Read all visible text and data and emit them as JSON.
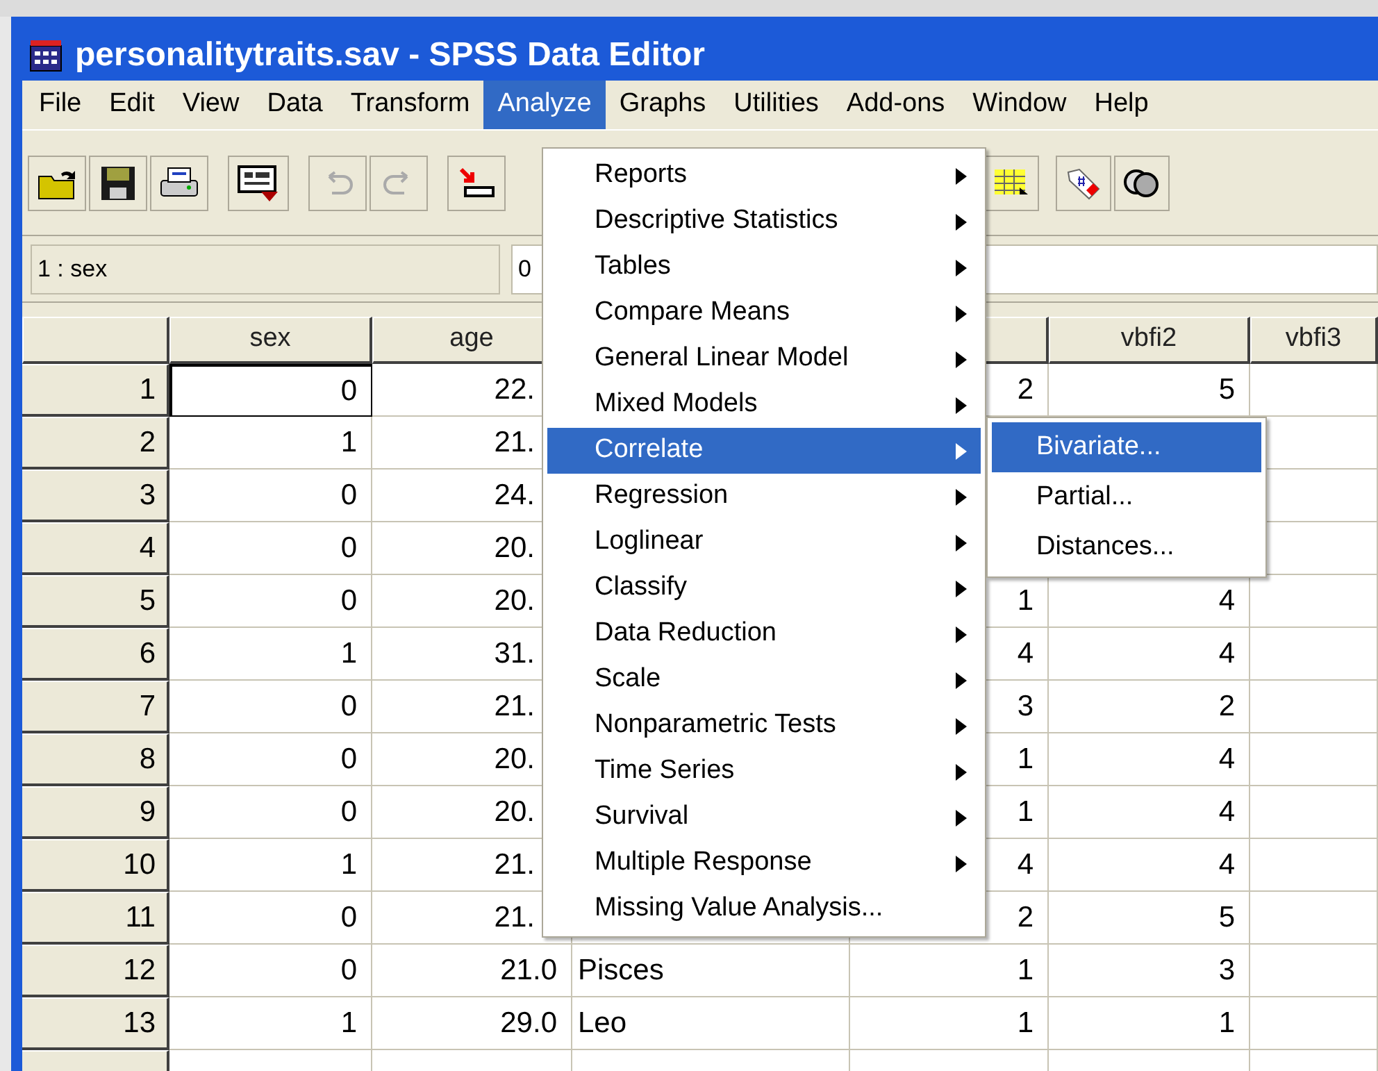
{
  "window": {
    "title": "personalitytraits.sav - SPSS Data Editor"
  },
  "menu_bar": [
    {
      "label": "File",
      "selected": false
    },
    {
      "label": "Edit",
      "selected": false
    },
    {
      "label": "View",
      "selected": false
    },
    {
      "label": "Data",
      "selected": false
    },
    {
      "label": "Transform",
      "selected": false
    },
    {
      "label": "Analyze",
      "selected": true
    },
    {
      "label": "Graphs",
      "selected": false
    },
    {
      "label": "Utilities",
      "selected": false
    },
    {
      "label": "Add-ons",
      "selected": false
    },
    {
      "label": "Window",
      "selected": false
    },
    {
      "label": "Help",
      "selected": false
    }
  ],
  "cell_editor": {
    "cell": "1 : sex",
    "value": "0"
  },
  "grid": {
    "columns": [
      null,
      "sex",
      "age",
      null,
      null,
      "vbfi2",
      "vbfi3"
    ],
    "rows": [
      {
        "cells": [
          "1",
          "0",
          "22.",
          null,
          "2",
          "5",
          null
        ],
        "active": true,
        "age_covered": true
      },
      {
        "cells": [
          "2",
          "1",
          "21.",
          null,
          null,
          null,
          null
        ],
        "active": false,
        "age_covered": true
      },
      {
        "cells": [
          "3",
          "0",
          "24.",
          null,
          null,
          null,
          null
        ],
        "active": false,
        "age_covered": true
      },
      {
        "cells": [
          "4",
          "0",
          "20.",
          null,
          null,
          null,
          null
        ],
        "active": false,
        "age_covered": true
      },
      {
        "cells": [
          "5",
          "0",
          "20.",
          null,
          "1",
          "4",
          null
        ],
        "active": false,
        "age_covered": true
      },
      {
        "cells": [
          "6",
          "1",
          "31.",
          null,
          "4",
          "4",
          null
        ],
        "active": false,
        "age_covered": true
      },
      {
        "cells": [
          "7",
          "0",
          "21.",
          null,
          "3",
          "2",
          null
        ],
        "active": false,
        "age_covered": true
      },
      {
        "cells": [
          "8",
          "0",
          "20.",
          null,
          "1",
          "4",
          null
        ],
        "active": false,
        "age_covered": true
      },
      {
        "cells": [
          "9",
          "0",
          "20.",
          null,
          "1",
          "4",
          null
        ],
        "active": false,
        "age_covered": true
      },
      {
        "cells": [
          "10",
          "1",
          "21.",
          null,
          "4",
          "4",
          null
        ],
        "active": false,
        "age_covered": true
      },
      {
        "cells": [
          "11",
          "0",
          "21.",
          null,
          "2",
          "5",
          null
        ],
        "active": false,
        "age_covered": true
      },
      {
        "cells": [
          "12",
          "0",
          "21.0",
          "Pisces",
          "1",
          "3",
          null
        ],
        "active": false,
        "age_covered": false
      },
      {
        "cells": [
          "13",
          "1",
          "29.0",
          "Leo",
          "1",
          "1",
          null
        ],
        "active": false,
        "age_covered": false
      }
    ]
  },
  "analyze_menu": [
    {
      "label": "Reports",
      "submenu": true,
      "selected": false
    },
    {
      "label": "Descriptive Statistics",
      "submenu": true,
      "selected": false
    },
    {
      "label": "Tables",
      "submenu": true,
      "selected": false
    },
    {
      "label": "Compare Means",
      "submenu": true,
      "selected": false
    },
    {
      "label": "General Linear Model",
      "submenu": true,
      "selected": false
    },
    {
      "label": "Mixed Models",
      "submenu": true,
      "selected": false
    },
    {
      "label": "Correlate",
      "submenu": true,
      "selected": true
    },
    {
      "label": "Regression",
      "submenu": true,
      "selected": false
    },
    {
      "label": "Loglinear",
      "submenu": true,
      "selected": false
    },
    {
      "label": "Classify",
      "submenu": true,
      "selected": false
    },
    {
      "label": "Data Reduction",
      "submenu": true,
      "selected": false
    },
    {
      "label": "Scale",
      "submenu": true,
      "selected": false
    },
    {
      "label": "Nonparametric Tests",
      "submenu": true,
      "selected": false
    },
    {
      "label": "Time Series",
      "submenu": true,
      "selected": false
    },
    {
      "label": "Survival",
      "submenu": true,
      "selected": false
    },
    {
      "label": "Multiple Response",
      "submenu": true,
      "selected": false
    },
    {
      "label": "Missing Value Analysis...",
      "submenu": false,
      "selected": false
    }
  ],
  "correlate_submenu": [
    {
      "label": "Bivariate...",
      "selected": true
    },
    {
      "label": "Partial...",
      "selected": false
    },
    {
      "label": "Distances...",
      "selected": false
    }
  ]
}
